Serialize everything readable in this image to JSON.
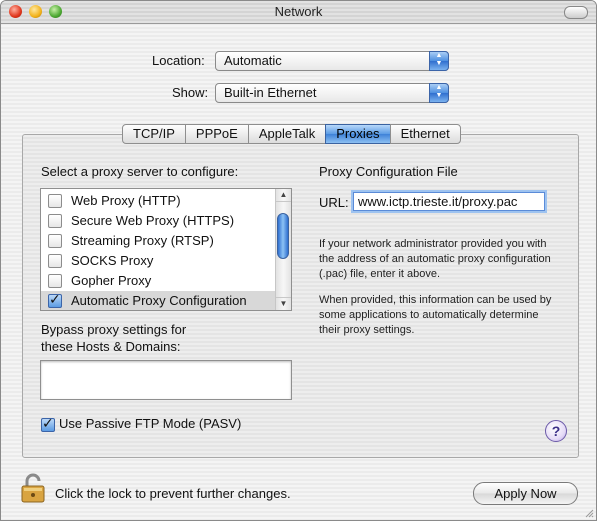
{
  "window": {
    "title": "Network"
  },
  "location": {
    "label": "Location:",
    "value": "Automatic"
  },
  "show": {
    "label": "Show:",
    "value": "Built-in Ethernet"
  },
  "tabs": [
    {
      "label": "TCP/IP",
      "active": false
    },
    {
      "label": "PPPoE",
      "active": false
    },
    {
      "label": "AppleTalk",
      "active": false
    },
    {
      "label": "Proxies",
      "active": true
    },
    {
      "label": "Ethernet",
      "active": false
    }
  ],
  "proxies": {
    "select_label": "Select a proxy server to configure:",
    "items": [
      {
        "label": "Web Proxy (HTTP)",
        "checked": false
      },
      {
        "label": "Secure Web Proxy (HTTPS)",
        "checked": false
      },
      {
        "label": "Streaming Proxy (RTSP)",
        "checked": false
      },
      {
        "label": "SOCKS Proxy",
        "checked": false
      },
      {
        "label": "Gopher Proxy",
        "checked": false
      },
      {
        "label": "Automatic Proxy Configuration",
        "checked": true
      }
    ],
    "bypass_label_line1": "Bypass proxy settings for",
    "bypass_label_line2": "these Hosts & Domains:",
    "bypass_value": "",
    "passive_ftp_label": "Use Passive FTP Mode (PASV)",
    "passive_ftp_checked": true
  },
  "config_file": {
    "heading": "Proxy Configuration File",
    "url_label": "URL:",
    "url_value": "www.ictp.trieste.it/proxy.pac",
    "info1": "If your network administrator provided you with the address of an automatic proxy configuration (.pac) file, enter it above.",
    "info2": "When provided, this information can be used by some applications to automatically determine their proxy settings."
  },
  "help_icon": "?",
  "footer": {
    "lock_text": "Click the lock to prevent further changes.",
    "apply_label": "Apply Now"
  },
  "colors": {
    "accent": "#4d8fe0"
  }
}
